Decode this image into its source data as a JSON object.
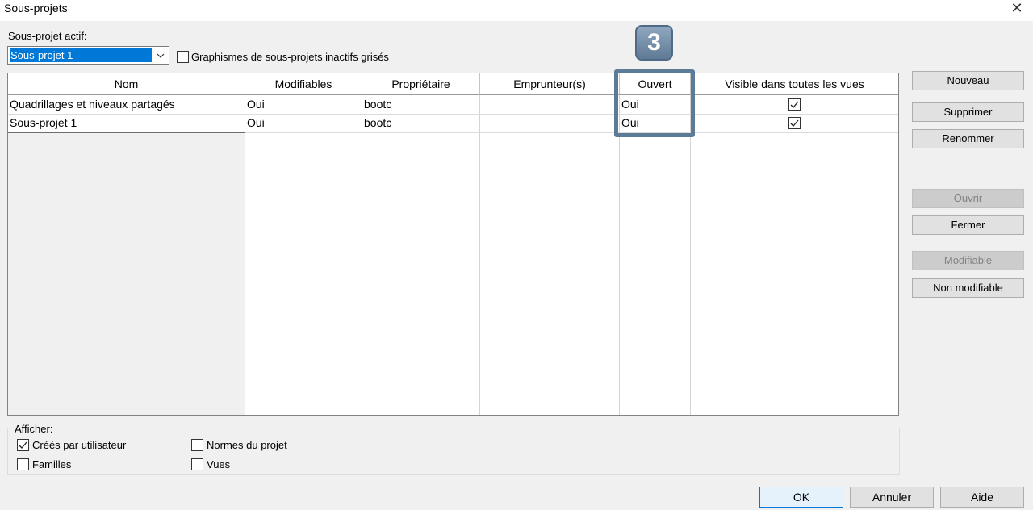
{
  "window": {
    "title": "Sous-projets",
    "close_glyph": "✕"
  },
  "active_subproject": {
    "label": "Sous-projet actif:",
    "value": "Sous-projet 1",
    "grey_inactive_label": "Graphismes de sous-projets inactifs grisés",
    "grey_inactive_checked": false
  },
  "table": {
    "headers": [
      "Nom",
      "Modifiables",
      "Propriétaire",
      "Emprunteur(s)",
      "Ouvert",
      "Visible dans toutes les vues"
    ],
    "rows": [
      {
        "name": "Quadrillages et niveaux partagés",
        "editable": "Oui",
        "owner": "bootc",
        "borrowers": "",
        "open": "Oui",
        "visible_all_views": true
      },
      {
        "name": "Sous-projet 1",
        "editable": "Oui",
        "owner": "bootc",
        "borrowers": "",
        "open": "Oui",
        "visible_all_views": true
      }
    ]
  },
  "buttons": {
    "new": "Nouveau",
    "delete": "Supprimer",
    "rename": "Renommer",
    "open": "Ouvrir",
    "close": "Fermer",
    "editable": "Modifiable",
    "non_editable": "Non modifiable"
  },
  "show": {
    "label": "Afficher:",
    "user_created": {
      "label": "Créés par utilisateur",
      "checked": true
    },
    "families": {
      "label": "Familles",
      "checked": false
    },
    "project_standards": {
      "label": "Normes du projet",
      "checked": false
    },
    "views": {
      "label": "Vues",
      "checked": false
    }
  },
  "footer": {
    "ok": "OK",
    "cancel": "Annuler",
    "help": "Aide"
  },
  "callout": {
    "number": "3",
    "color": "#5c7b96"
  }
}
